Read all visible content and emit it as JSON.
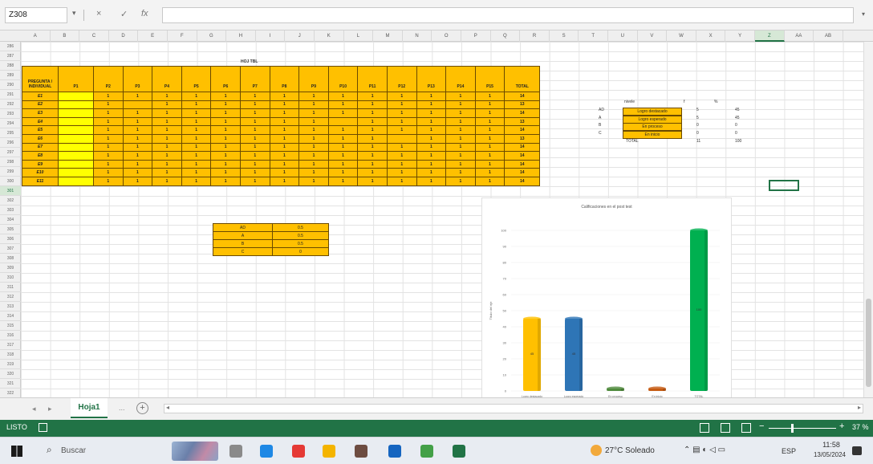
{
  "formula_bar": {
    "name_box": "Z308",
    "fx_label": "fx",
    "cancel_icon": "×",
    "enter_icon": "✓",
    "formula": ""
  },
  "columns": [
    "A",
    "B",
    "C",
    "D",
    "E",
    "F",
    "G",
    "H",
    "I",
    "J",
    "K",
    "L",
    "M",
    "N",
    "O",
    "P",
    "Q",
    "R",
    "S",
    "T",
    "U",
    "V",
    "W",
    "X",
    "Y",
    "Z",
    "AA",
    "AB"
  ],
  "sheet": {
    "title_cell": "HOJ TBL",
    "table_headers": [
      "PREGUNTA / INDIVIDUAL",
      "P1",
      "P2",
      "P3",
      "P4",
      "P5",
      "P6",
      "P7",
      "P8",
      "P9",
      "P10",
      "P11",
      "P12",
      "P13",
      "P14",
      "P15",
      "TOTAL"
    ],
    "table_rows": [
      [
        "E1",
        "",
        "1",
        "1",
        "1",
        "1",
        "1",
        "1",
        "1",
        "1",
        "1",
        "1",
        "1",
        "1",
        "1",
        "1",
        "14"
      ],
      [
        "E2",
        "",
        "1",
        "",
        "1",
        "1",
        "1",
        "1",
        "1",
        "1",
        "1",
        "1",
        "1",
        "1",
        "1",
        "1",
        "13"
      ],
      [
        "E3",
        "",
        "1",
        "1",
        "1",
        "1",
        "1",
        "1",
        "1",
        "1",
        "1",
        "1",
        "1",
        "1",
        "1",
        "1",
        "14"
      ],
      [
        "E4",
        "",
        "1",
        "1",
        "1",
        "1",
        "1",
        "1",
        "1",
        "1",
        "",
        "1",
        "1",
        "1",
        "1",
        "1",
        "13"
      ],
      [
        "E5",
        "",
        "1",
        "1",
        "1",
        "1",
        "1",
        "1",
        "1",
        "1",
        "1",
        "1",
        "1",
        "1",
        "1",
        "1",
        "14"
      ],
      [
        "E6",
        "",
        "1",
        "1",
        "1",
        "1",
        "1",
        "1",
        "1",
        "1",
        "1",
        "1",
        "",
        "1",
        "1",
        "1",
        "13"
      ],
      [
        "E7",
        "",
        "1",
        "1",
        "1",
        "1",
        "1",
        "1",
        "1",
        "1",
        "1",
        "1",
        "1",
        "1",
        "1",
        "1",
        "14"
      ],
      [
        "E8",
        "",
        "1",
        "1",
        "1",
        "1",
        "1",
        "1",
        "1",
        "1",
        "1",
        "1",
        "1",
        "1",
        "1",
        "1",
        "14"
      ],
      [
        "E9",
        "",
        "1",
        "1",
        "1",
        "1",
        "1",
        "1",
        "1",
        "1",
        "1",
        "1",
        "1",
        "1",
        "1",
        "1",
        "14"
      ],
      [
        "E10",
        "",
        "1",
        "1",
        "1",
        "1",
        "1",
        "1",
        "1",
        "1",
        "1",
        "1",
        "1",
        "1",
        "1",
        "1",
        "14"
      ],
      [
        "E11",
        "",
        "1",
        "1",
        "1",
        "1",
        "1",
        "1",
        "1",
        "1",
        "1",
        "1",
        "1",
        "1",
        "1",
        "1",
        "14"
      ]
    ],
    "small_table": [
      [
        "AD",
        "0.5"
      ],
      [
        "A",
        "0.5"
      ],
      [
        "B",
        "0.5"
      ],
      [
        "C",
        "0"
      ]
    ],
    "right_table": {
      "header_left": "nivele",
      "header_a": "f",
      "header_b": "%",
      "rows": [
        {
          "code": "AD",
          "label": "Logro destacado",
          "f": "5",
          "pct": "45"
        },
        {
          "code": "A",
          "label": "Logro esperado",
          "f": "5",
          "pct": "45"
        },
        {
          "code": "B",
          "label": "En proceso",
          "f": "0",
          "pct": "0"
        },
        {
          "code": "C",
          "label": "En inicio",
          "f": "0",
          "pct": "0"
        }
      ],
      "total_label": "TOTAL",
      "total_f": "11",
      "total_pct": "100"
    }
  },
  "chart_data": {
    "type": "bar",
    "title": "Calificaciones en el post test",
    "categories": [
      "Logro destacado",
      "Logro esperado",
      "En proceso",
      "En inicio",
      "TOTAL"
    ],
    "values": [
      45,
      45,
      0,
      0,
      100
    ],
    "colors": [
      "#ffc000",
      "#2e75b6",
      "#4f8a3c",
      "#c55a11",
      "#00b050"
    ],
    "ylim": [
      0,
      100
    ],
    "yticks": [
      "0",
      "10",
      "20",
      "30",
      "40",
      "50",
      "60",
      "70",
      "80",
      "90",
      "100"
    ],
    "ylabel": "Título del eje",
    "grid": true
  },
  "tabs": {
    "sheet_name": "Hoja1",
    "more": "...",
    "add": "+"
  },
  "status_bar": {
    "mode": "LISTO",
    "zoom": "37 %",
    "zoom_fraction": 0.33
  },
  "taskbar": {
    "search_placeholder": "Buscar",
    "weather": "27°C Soleado",
    "language": "ESP",
    "time": "11:58",
    "date": "13/05/2024",
    "app_colors": [
      "#8a8a8a",
      "#1e88e5",
      "#e53935",
      "#f4b400",
      "#6d4c41",
      "#1565c0",
      "#43a047",
      "#217346"
    ]
  }
}
